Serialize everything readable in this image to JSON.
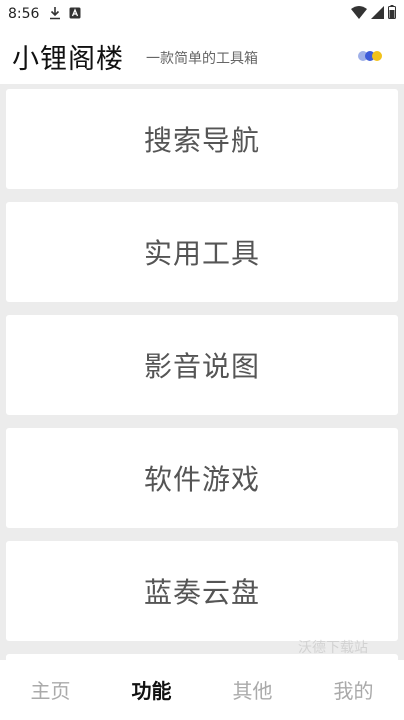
{
  "status_bar": {
    "time": "8:56",
    "left_icons": [
      "download-icon",
      "a-notification-icon"
    ],
    "right_icons": [
      "wifi-icon",
      "cellular-signal-icon",
      "battery-icon"
    ]
  },
  "header": {
    "title": "小锂阁楼",
    "subtitle": "一款简单的工具箱",
    "theme_icon": "color-dots-icon",
    "theme_colors": [
      "#9fb0e8",
      "#3d5bd9",
      "#f2c21b"
    ]
  },
  "menu": [
    {
      "label": "搜索导航"
    },
    {
      "label": "实用工具"
    },
    {
      "label": "影音说图"
    },
    {
      "label": "软件游戏"
    },
    {
      "label": "蓝奏云盘"
    }
  ],
  "watermark": "沃德下载站",
  "tabs": [
    {
      "label": "主页",
      "active": false
    },
    {
      "label": "功能",
      "active": true
    },
    {
      "label": "其他",
      "active": false
    },
    {
      "label": "我的",
      "active": false
    }
  ],
  "colors": {
    "background": "#ececec",
    "card": "#ffffff",
    "card_text": "#555555",
    "tab_active": "#111111",
    "tab_inactive": "#aaaaaa"
  }
}
